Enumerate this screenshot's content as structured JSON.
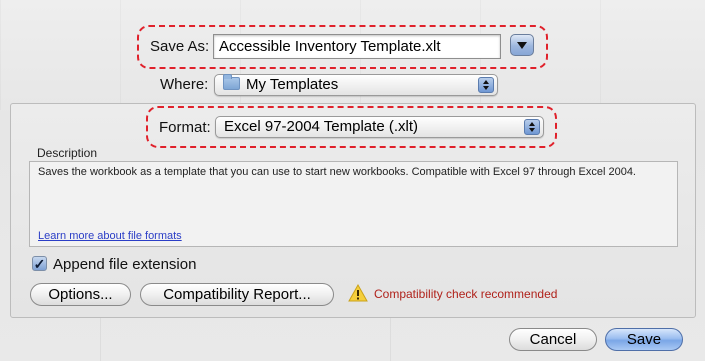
{
  "save_as": {
    "label": "Save As:",
    "value": "Accessible Inventory Template.xlt"
  },
  "where": {
    "label": "Where:",
    "value": "My Templates",
    "icon": "folder-icon"
  },
  "format": {
    "label": "Format:",
    "value": "Excel 97-2004 Template (.xlt)"
  },
  "description": {
    "heading": "Description",
    "text": "Saves the workbook as a template that you can use to start new workbooks. Compatible with Excel 97 through Excel 2004.",
    "link": "Learn more about file formats"
  },
  "append_extension": {
    "label": "Append file extension",
    "checked": true
  },
  "buttons": {
    "options": "Options...",
    "compatibility_report": "Compatibility Report...",
    "cancel": "Cancel",
    "save": "Save"
  },
  "warning": {
    "icon": "warning-icon",
    "text": "Compatibility check recommended",
    "color": "#b0221b"
  },
  "colors": {
    "highlight": "#e0212b",
    "default_button": "#7aa6e6",
    "link": "#2b3ec6"
  }
}
